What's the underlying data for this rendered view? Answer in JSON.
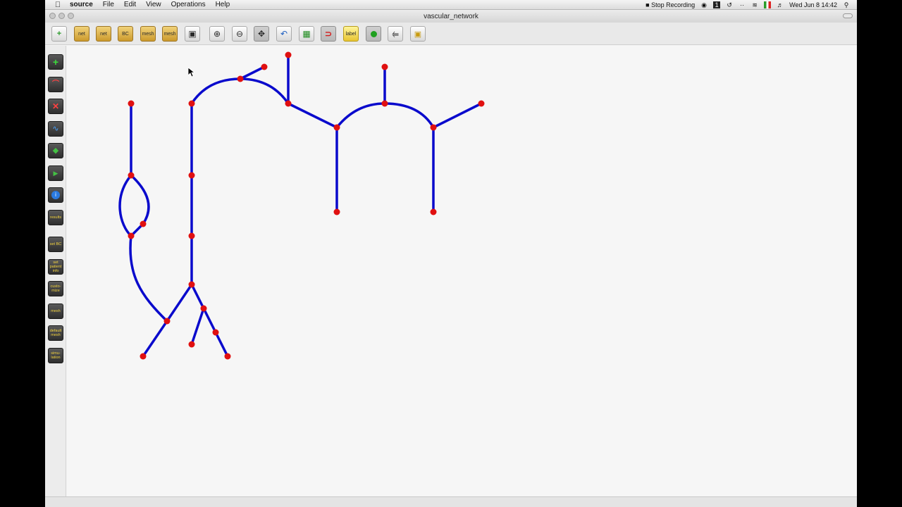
{
  "menubar": {
    "app_name": "source",
    "menus": [
      "File",
      "Edit",
      "View",
      "Operations",
      "Help"
    ],
    "stop_recording": "Stop Recording",
    "clock": "Wed Jun 8  14:42"
  },
  "window": {
    "title": "vascular_network"
  },
  "toolbar": {
    "new_label": "",
    "net_label": "net",
    "net2_label": "net",
    "bc_label": "BC",
    "mesh_label": "mesh",
    "mesh2_label": "mesh",
    "label_label": "label"
  },
  "sidebar": {
    "set_bc": "set BC",
    "set_patient_info": "set patient info",
    "customize": "custo-mize",
    "mesh": "mesh",
    "default_mesh": "default mesh",
    "simulation": "simu-lation",
    "results": "results"
  },
  "network": {
    "edge_color": "#0a0acc",
    "node_color": "#e01010",
    "nodes": [
      {
        "id": "n1"
      },
      {
        "id": "n2"
      },
      {
        "id": "n3"
      },
      {
        "id": "n4"
      },
      {
        "id": "n5"
      },
      {
        "id": "n6"
      },
      {
        "id": "n7"
      },
      {
        "id": "n8"
      },
      {
        "id": "n9"
      },
      {
        "id": "n10"
      },
      {
        "id": "n11"
      },
      {
        "id": "n12"
      },
      {
        "id": "n13"
      },
      {
        "id": "n14"
      },
      {
        "id": "n15"
      },
      {
        "id": "n16"
      },
      {
        "id": "n17"
      },
      {
        "id": "n18"
      },
      {
        "id": "n19"
      },
      {
        "id": "n20"
      },
      {
        "id": "n21"
      },
      {
        "id": "n22"
      },
      {
        "id": "n23"
      },
      {
        "id": "n24"
      },
      {
        "id": "n25"
      }
    ]
  }
}
